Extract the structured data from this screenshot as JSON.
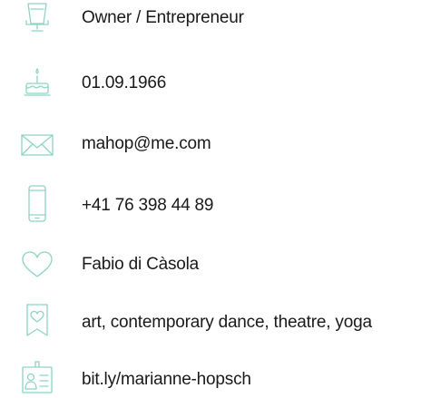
{
  "colors": {
    "icon": "#8fd3c2",
    "text": "#1a1a1a",
    "background": "#ffffff"
  },
  "profile": {
    "items": [
      {
        "icon": "chair-icon",
        "text": "Owner / Entrepreneur"
      },
      {
        "icon": "birthday-cake-icon",
        "text": "01.09.1966"
      },
      {
        "icon": "mail-icon",
        "text": "mahop@me.com"
      },
      {
        "icon": "mobile-phone-icon",
        "text": "+41 76 398 44 89"
      },
      {
        "icon": "heart-icon",
        "text": "Fabio di Càsola"
      },
      {
        "icon": "bookmark-heart-icon",
        "text": "art, contemporary dance, theatre, yoga"
      },
      {
        "icon": "profile-card-icon",
        "text": "bit.ly/marianne-hopsch"
      }
    ]
  }
}
